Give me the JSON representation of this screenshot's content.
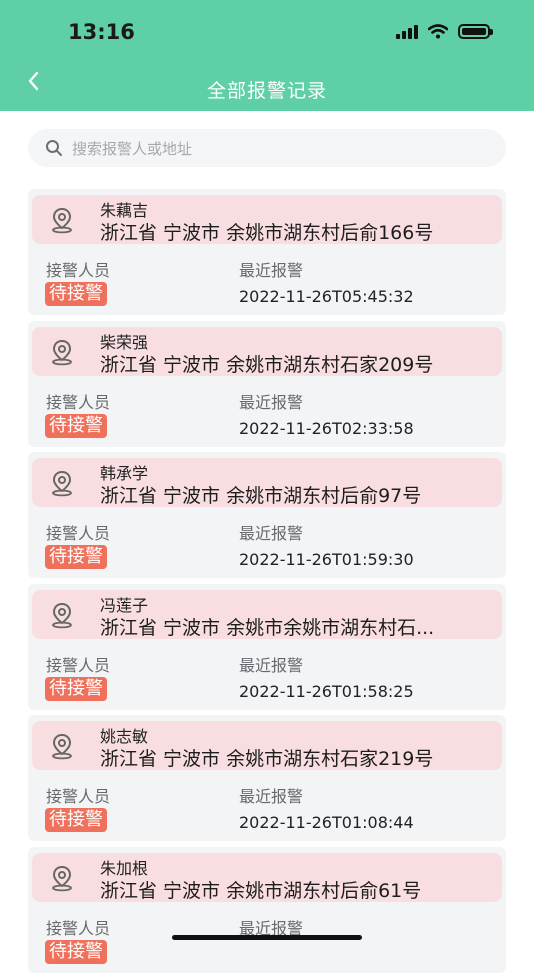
{
  "colors": {
    "header": "#5fcfa6",
    "badge": "#ef705b",
    "card_top": "#f8dee1"
  },
  "status_bar": {
    "time": "13:16"
  },
  "nav": {
    "title": "全部报警记录",
    "back_icon": "chevron-left-icon"
  },
  "search": {
    "placeholder": "搜索报警人或地址"
  },
  "labels": {
    "responder": "接警人员",
    "recent": "最近报警"
  },
  "records": [
    {
      "name": "朱藕吉",
      "address": "浙江省 宁波市 余姚市湖东村后俞166号",
      "status": "待接警",
      "time": "2022-11-26T05:45:32"
    },
    {
      "name": "柴荣强",
      "address": "浙江省 宁波市 余姚市湖东村石家209号",
      "status": "待接警",
      "time": "2022-11-26T02:33:58"
    },
    {
      "name": "韩承学",
      "address": "浙江省 宁波市 余姚市湖东村后俞97号",
      "status": "待接警",
      "time": "2022-11-26T01:59:30"
    },
    {
      "name": "冯莲子",
      "address": "浙江省 宁波市 余姚市余姚市湖东村石...",
      "status": "待接警",
      "time": "2022-11-26T01:58:25"
    },
    {
      "name": "姚志敏",
      "address": "浙江省 宁波市 余姚市湖东村石家219号",
      "status": "待接警",
      "time": "2022-11-26T01:08:44"
    },
    {
      "name": "朱加根",
      "address": "浙江省 宁波市 余姚市湖东村后俞61号",
      "status": "待接警",
      "time": ""
    }
  ]
}
